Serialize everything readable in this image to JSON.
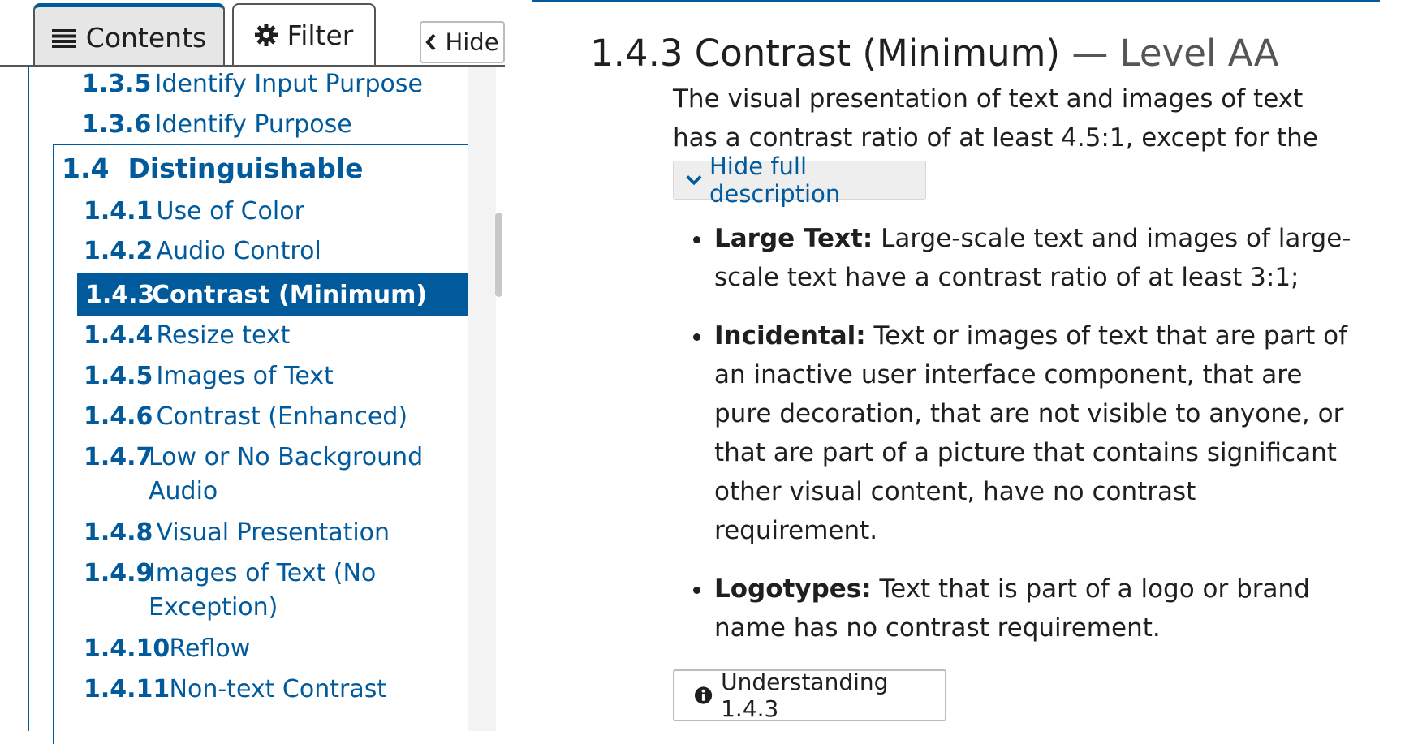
{
  "sidebar": {
    "tabs": [
      {
        "label": "Contents",
        "icon": "list-icon"
      },
      {
        "label": "Filter",
        "icon": "gear-icon"
      }
    ],
    "hide_label": "Hide",
    "toc": {
      "prev_items": [
        {
          "num": "1.3.5",
          "label": "Identify Input Purpose"
        },
        {
          "num": "1.3.6",
          "label": "Identify Purpose"
        }
      ],
      "group": {
        "num": "1.4",
        "label": "Distinguishable"
      },
      "items": [
        {
          "num": "1.4.1",
          "label": "Use of Color"
        },
        {
          "num": "1.4.2",
          "label": "Audio Control"
        },
        {
          "num": "1.4.3",
          "label": "Contrast (Minimum)"
        },
        {
          "num": "1.4.4",
          "label": "Resize text"
        },
        {
          "num": "1.4.5",
          "label": "Images of Text"
        },
        {
          "num": "1.4.6",
          "label": "Contrast (Enhanced)"
        },
        {
          "num": "1.4.7",
          "label": "Low or No Background",
          "label2": "Audio"
        },
        {
          "num": "1.4.8",
          "label": "Visual Presentation"
        },
        {
          "num": "1.4.9",
          "label": "Images of Text (No",
          "label2": "Exception)"
        },
        {
          "num": "1.4.10",
          "label": "Reflow"
        },
        {
          "num": "1.4.11",
          "label": "Non-text Contrast"
        }
      ],
      "active_index": 2
    }
  },
  "main": {
    "title": "1.4.3 Contrast (Minimum)",
    "title_sep": " — ",
    "level": "Level AA",
    "description": "The visual presentation of text and images of text has a contrast ratio of at least 4.5:1, except for the following:",
    "toggle_label": "Hide full description",
    "bullets": [
      {
        "term": "Large Text:",
        "text": " Large-scale text and images of large-scale text have a contrast ratio of at least 3:1;"
      },
      {
        "term": "Incidental:",
        "text": " Text or images of text that are part of an inactive user interface component, that are pure decoration, that are not visible to anyone, or that are part of a picture that contains significant other visual content, have no contrast requirement."
      },
      {
        "term": "Logotypes:",
        "text": " Text that is part of a logo or brand name has no contrast requirement."
      }
    ],
    "understanding_label": "Understanding 1.4.3"
  },
  "colors": {
    "accent": "#005a9c",
    "text": "#1f1f1f",
    "button_bg": "#eeeeee"
  }
}
